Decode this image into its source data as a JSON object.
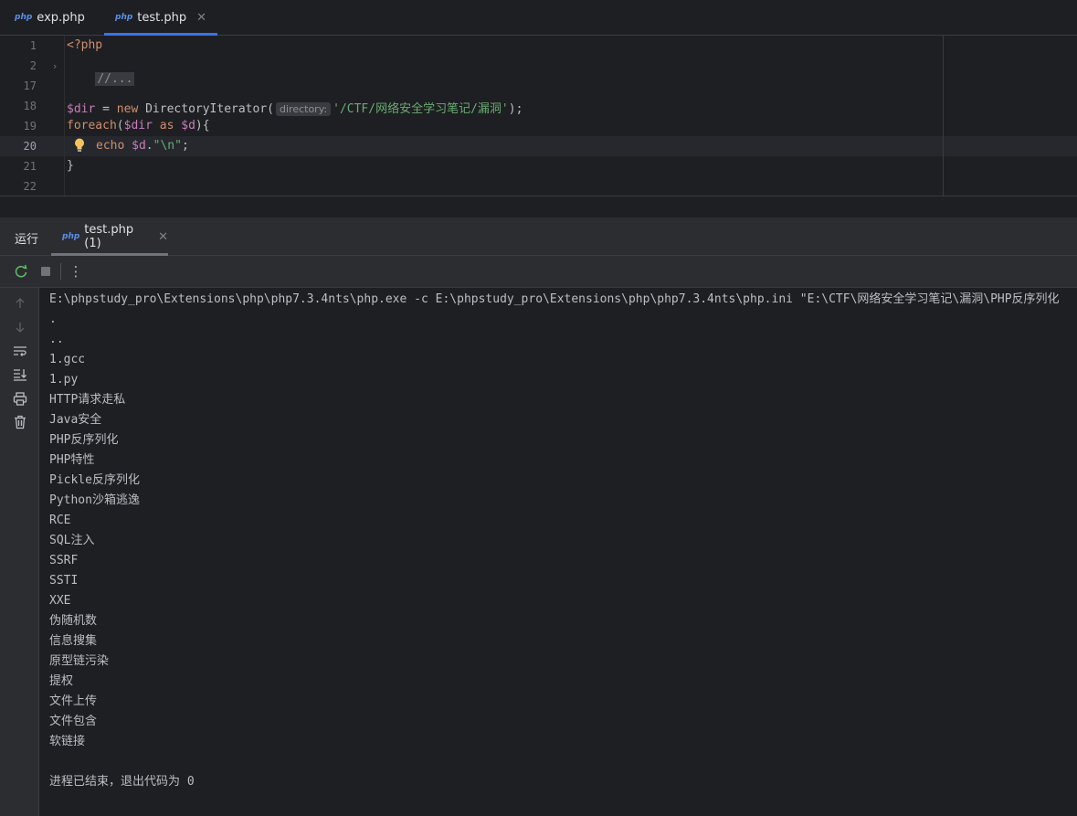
{
  "editor_tabs": [
    {
      "icon": "php",
      "label": "exp.php",
      "active": false
    },
    {
      "icon": "php",
      "label": "test.php",
      "active": true,
      "close": "✕"
    }
  ],
  "editor": {
    "line_numbers": [
      "1",
      "2",
      "17",
      "18",
      "19",
      "20",
      "21",
      "22"
    ],
    "lines": {
      "l1": "<?php",
      "l2_folded": "//...",
      "l18_var": "$dir",
      "l18_eq": " = ",
      "l18_new": "new",
      "l18_class": " DirectoryIterator(",
      "l18_hint": "directory:",
      "l18_str": "'/CTF/网络安全学习笔记/漏洞'",
      "l18_end": ");",
      "l19_kw": "foreach",
      "l19_open": "(",
      "l19_var1": "$dir",
      "l19_as": " as ",
      "l19_var2": "$d",
      "l19_end": "){",
      "l20_echo": "echo",
      "l20_var": " $d",
      "l20_dot": ".",
      "l20_str": "\"\\n\"",
      "l20_end": ";",
      "l21": "}"
    }
  },
  "run_panel": {
    "title": "运行",
    "tab_icon": "php",
    "tab_label": "test.php (1)",
    "tab_close": "✕",
    "toolbar_icons": [
      "rerun-icon",
      "stop-icon",
      "more-options-icon"
    ],
    "more_label": "⋮",
    "side_icons": [
      "up-arrow-icon",
      "down-arrow-icon",
      "soft-wrap-icon",
      "scroll-to-end-icon",
      "print-icon",
      "trash-icon"
    ]
  },
  "console": {
    "lines": [
      "E:\\phpstudy_pro\\Extensions\\php\\php7.3.4nts\\php.exe -c E:\\phpstudy_pro\\Extensions\\php\\php7.3.4nts\\php.ini \"E:\\CTF\\网络安全学习笔记\\漏洞\\PHP反序列化",
      ".",
      "..",
      "1.gcc",
      "1.py",
      "HTTP请求走私",
      "Java安全",
      "PHP反序列化",
      "PHP特性",
      "Pickle反序列化",
      "Python沙箱逃逸",
      "RCE",
      "SQL注入",
      "SSRF",
      "SSTI",
      "XXE",
      "伪随机数",
      "信息搜集",
      "原型链污染",
      "提权",
      "文件上传",
      "文件包含",
      "软链接",
      "",
      "进程已结束，退出代码为 0"
    ]
  },
  "colors": {
    "accent": "#3574f0",
    "keyword": "#cf8e6d",
    "variable": "#c77dbb",
    "string": "#6aab73",
    "bulb": "#f2c55c"
  }
}
